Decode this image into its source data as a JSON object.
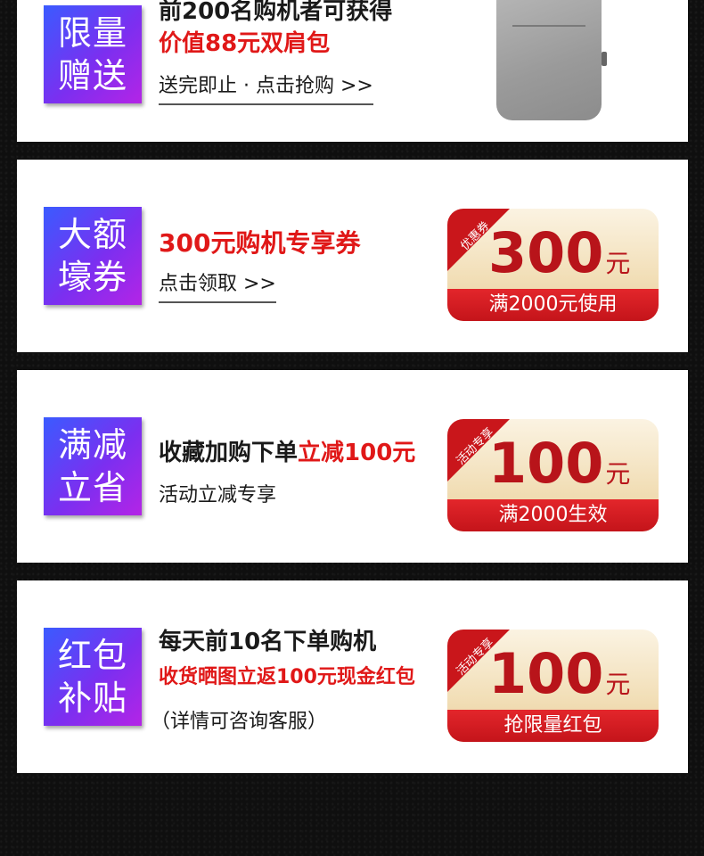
{
  "cards": [
    {
      "tag": [
        "限量",
        "赠送"
      ],
      "line1": "前200名购机者可获得",
      "line2": "价值88元双肩包",
      "link": "送完即止 · 点击抢购 >>",
      "image": "backpack-gray"
    },
    {
      "tag": [
        "大额",
        "壕券"
      ],
      "line1": "300元购机专享券",
      "link": "点击领取 >>",
      "coupon": {
        "corner": "优惠券",
        "amount": "300",
        "unit": "元",
        "band": "满2000元使用"
      }
    },
    {
      "tag": [
        "满减",
        "立省"
      ],
      "line1a": "收藏加购下单",
      "line1b": "立减100元",
      "line2": "活动立减专享",
      "coupon": {
        "corner": "活动专享",
        "amount": "100",
        "unit": "元",
        "band": "满2000生效"
      }
    },
    {
      "tag": [
        "红包",
        "补贴"
      ],
      "line1": "每天前10名下单购机",
      "line2": "收货晒图立返100元现金红包",
      "line3": "（详情可咨询客服）",
      "coupon": {
        "corner": "活动专享",
        "amount": "100",
        "unit": "元",
        "band": "抢限量红包"
      }
    }
  ],
  "colors": {
    "accent_red": "#e01818",
    "tag_gradient": [
      "#3a5bff",
      "#b424e6"
    ],
    "coupon_band": "#c4141a"
  }
}
